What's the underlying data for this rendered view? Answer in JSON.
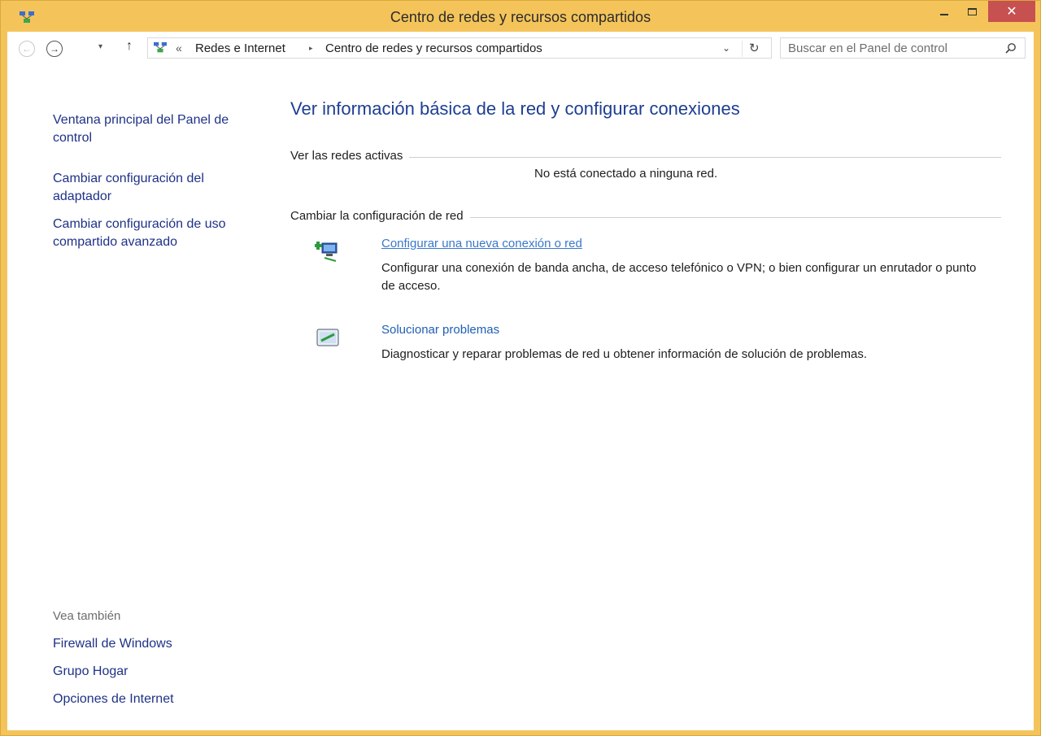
{
  "window": {
    "title": "Centro de redes y recursos compartidos",
    "close_glyph": "✕",
    "colors": {
      "frame": "#f4c45b",
      "close": "#c75050",
      "link": "#1e3287",
      "title": "#1e3e92"
    }
  },
  "nav": {
    "back_glyph": "←",
    "forward_glyph": "→",
    "recent_glyph": "▾",
    "up_glyph": "↑"
  },
  "address": {
    "overflow": "«",
    "crumbs": [
      "Redes e Internet",
      "Centro de redes y recursos compartidos"
    ],
    "separator": "▸",
    "dropdown_glyph": "⌄",
    "refresh_glyph": "↻"
  },
  "search": {
    "placeholder": "Buscar en el Panel de control"
  },
  "sidebar": {
    "tasks": [
      "Ventana principal del Panel de control",
      "Cambiar configuración del adaptador",
      "Cambiar configuración de uso compartido avanzado"
    ],
    "see_also_title": "Vea también",
    "see_also": [
      "Firewall de Windows",
      "Grupo Hogar",
      "Opciones de Internet"
    ]
  },
  "main": {
    "title": "Ver información básica de la red y configurar conexiones",
    "active_networks_label": "Ver las redes activas",
    "no_network_text": "No está conectado a ninguna red.",
    "change_settings_label": "Cambiar la configuración de red",
    "items": [
      {
        "icon": "new-connection-icon",
        "link": "Configurar una nueva conexión o red",
        "description": "Configurar una conexión de banda ancha, de acceso telefónico o VPN; o bien configurar un enrutador o punto de acceso."
      },
      {
        "icon": "troubleshoot-icon",
        "link": "Solucionar problemas",
        "description": "Diagnosticar y reparar problemas de red u obtener información de solución de problemas."
      }
    ]
  }
}
